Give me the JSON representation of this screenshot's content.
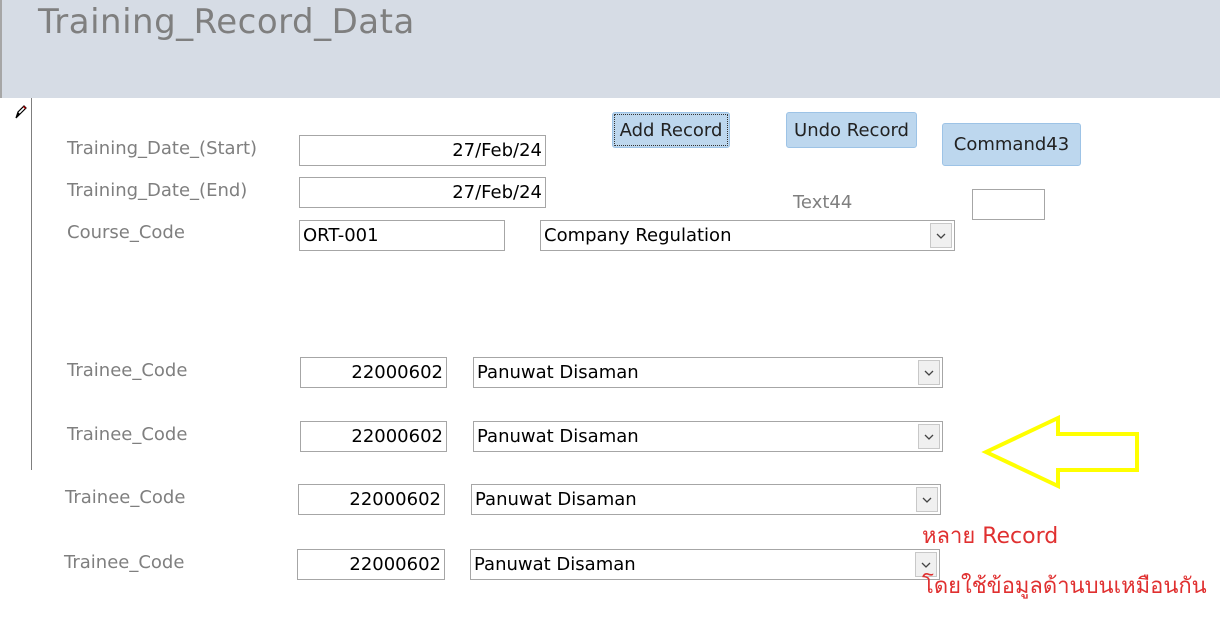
{
  "form": {
    "title": "Training_Record_Data"
  },
  "fields": {
    "start_label": "Training_Date_(Start)",
    "start_value": "27/Feb/24",
    "end_label": "Training_Date_(End)",
    "end_value": "27/Feb/24",
    "course_label": "Course_Code",
    "course_code": "ORT-001",
    "course_name": "Company Regulation",
    "text44_label": "Text44",
    "text44_value": ""
  },
  "buttons": {
    "add_record": "Add Record",
    "undo_record": "Undo Record",
    "command43": "Command43"
  },
  "trainees": [
    {
      "label": "Trainee_Code",
      "code": "22000602",
      "name": "Panuwat Disaman"
    },
    {
      "label": "Trainee_Code",
      "code": "22000602",
      "name": "Panuwat Disaman"
    },
    {
      "label": "Trainee_Code",
      "code": "22000602",
      "name": "Panuwat Disaman"
    },
    {
      "label": "Trainee_Code",
      "code": "22000602",
      "name": "Panuwat Disaman"
    }
  ],
  "annotation": {
    "line1": "หลาย Record",
    "line2": "โดยใช้ข้อมูลด้านบนเหมือนกัน",
    "arrow_color": "#ffff00",
    "text_color": "#e03030"
  }
}
